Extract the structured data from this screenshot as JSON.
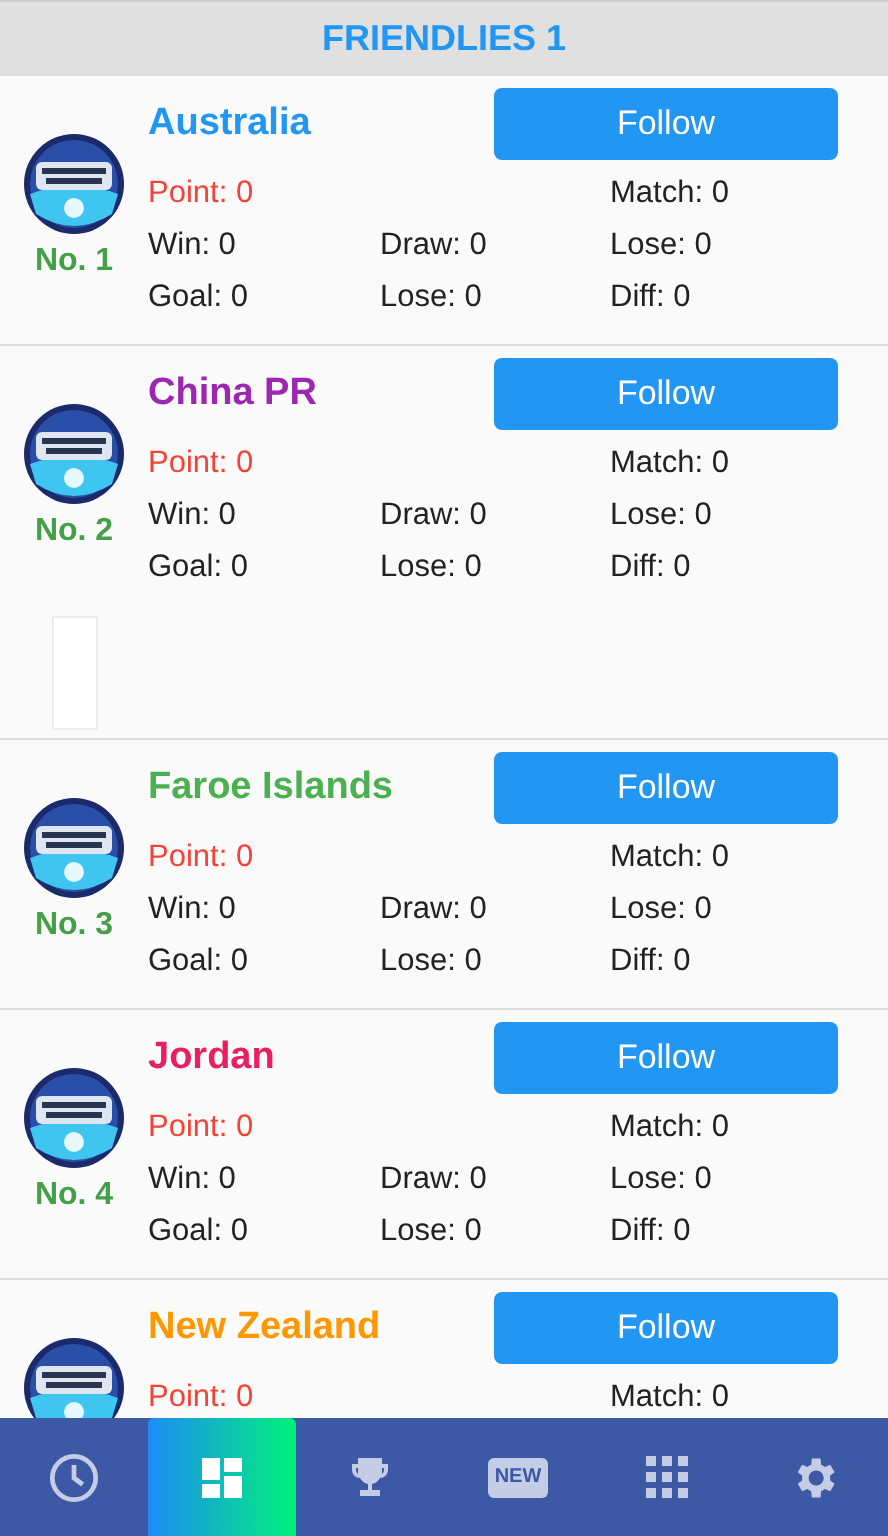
{
  "header": {
    "title": "FRIENDLIES 1"
  },
  "teams": [
    {
      "name": "Australia",
      "color": "#2196f3",
      "rank": "No. 1",
      "button": "Follow",
      "point": "Point: 0",
      "match": "Match: 0",
      "win": "Win: 0",
      "draw": "Draw: 0",
      "lose": "Lose: 0",
      "goal": "Goal: 0",
      "goal_lose": "Lose: 0",
      "diff": "Diff: 0",
      "blank_block": false
    },
    {
      "name": "China PR",
      "color": "#9c27b0",
      "rank": "No. 2",
      "button": "Follow",
      "point": "Point: 0",
      "match": "Match: 0",
      "win": "Win: 0",
      "draw": "Draw: 0",
      "lose": "Lose: 0",
      "goal": "Goal: 0",
      "goal_lose": "Lose: 0",
      "diff": "Diff: 0",
      "blank_block": true
    },
    {
      "name": "Faroe Islands",
      "color": "#4caf50",
      "rank": "No. 3",
      "button": "Follow",
      "point": "Point: 0",
      "match": "Match: 0",
      "win": "Win: 0",
      "draw": "Draw: 0",
      "lose": "Lose: 0",
      "goal": "Goal: 0",
      "goal_lose": "Lose: 0",
      "diff": "Diff: 0",
      "blank_block": false
    },
    {
      "name": "Jordan",
      "color": "#e91e63",
      "rank": "No. 4",
      "button": "Follow",
      "point": "Point: 0",
      "match": "Match: 0",
      "win": "Win: 0",
      "draw": "Draw: 0",
      "lose": "Lose: 0",
      "goal": "Goal: 0",
      "goal_lose": "Lose: 0",
      "diff": "Diff: 0",
      "blank_block": false
    },
    {
      "name": "New Zealand",
      "color": "#ff9800",
      "button": "Follow",
      "point": "Point: 0",
      "match": "Match: 0",
      "blank_block": false
    }
  ],
  "nav": [
    {
      "kind": "clock",
      "selected": false
    },
    {
      "kind": "dashboard",
      "selected": true
    },
    {
      "kind": "trophy",
      "selected": false
    },
    {
      "kind": "badge",
      "label": "NEW",
      "selected": false
    },
    {
      "kind": "grid",
      "selected": false
    },
    {
      "kind": "settings",
      "selected": false
    }
  ]
}
